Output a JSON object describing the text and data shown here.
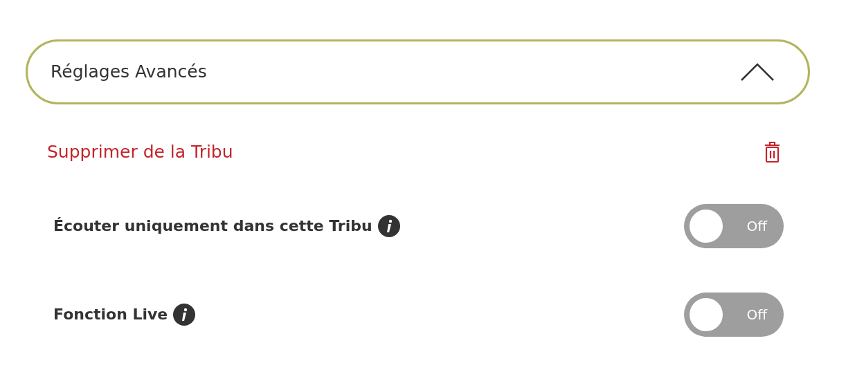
{
  "accordion": {
    "title": "Réglages Avancés",
    "expanded": true
  },
  "delete_action": {
    "label": "Supprimer de la Tribu"
  },
  "settings": [
    {
      "label": "Écouter uniquement dans cette Tribu",
      "on": false,
      "toggle_text": "Off"
    },
    {
      "label": "Fonction Live",
      "on": false,
      "toggle_text": "Off"
    }
  ]
}
